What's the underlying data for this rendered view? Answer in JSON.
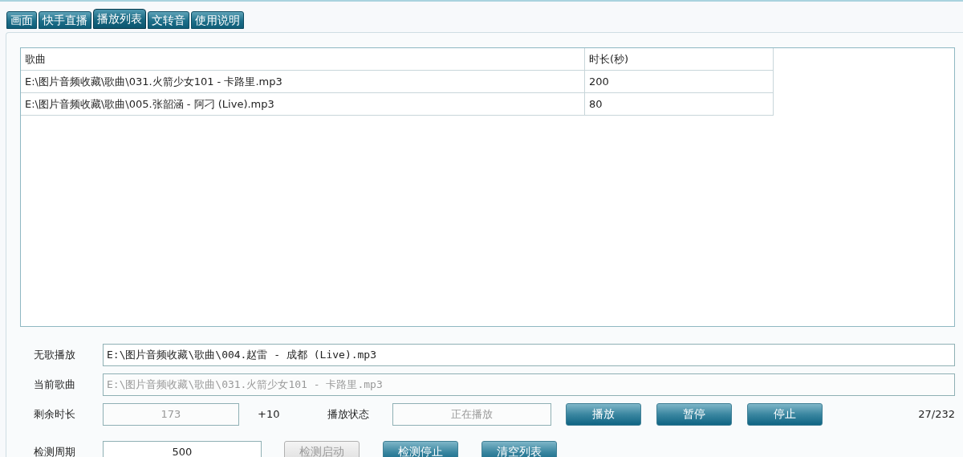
{
  "tabs": [
    {
      "label": "画面",
      "selected": false
    },
    {
      "label": "快手直播",
      "selected": false
    },
    {
      "label": "播放列表",
      "selected": true
    },
    {
      "label": "文转音",
      "selected": false
    },
    {
      "label": "使用说明",
      "selected": false
    }
  ],
  "playlist": {
    "columns": [
      "歌曲",
      "时长(秒)"
    ],
    "rows": [
      [
        "E:\\图片音频收藏\\歌曲\\031.火箭少女101 - 卡路里.mp3",
        "200"
      ],
      [
        "E:\\图片音频收藏\\歌曲\\005.张韶涵 - 阿刁 (Live).mp3",
        "80"
      ]
    ]
  },
  "form_rows": [
    {
      "items": [
        {
          "kind": "label",
          "text": "无歌播放"
        },
        {
          "kind": "field",
          "value": "E:\\图片音频收藏\\歌曲\\004.赵雷 - 成都 (Live).mp3",
          "disabled": false
        }
      ]
    },
    {
      "items": [
        {
          "kind": "label",
          "text": "当前歌曲"
        },
        {
          "kind": "field",
          "value": "E:\\图片音频收藏\\歌曲\\031.火箭少女101 - 卡路里.mp3",
          "disabled": true
        }
      ]
    },
    {
      "items": [
        {
          "kind": "label",
          "text": "剩余时长"
        },
        {
          "kind": "field",
          "value": "173",
          "disabled": true
        },
        {
          "kind": "text",
          "text": "+10"
        },
        {
          "kind": "label",
          "text": "播放状态"
        },
        {
          "kind": "field",
          "value": "正在播放",
          "disabled": true
        },
        {
          "kind": "button",
          "label": "播放",
          "disabled": false
        },
        {
          "kind": "button",
          "label": "暂停",
          "disabled": false
        },
        {
          "kind": "button",
          "label": "停止",
          "disabled": false
        },
        {
          "kind": "counter",
          "text": "27/232"
        }
      ]
    },
    {
      "items": [
        {
          "kind": "label",
          "text": "检测周期"
        },
        {
          "kind": "field",
          "value": "500",
          "disabled": false
        },
        {
          "kind": "button",
          "label": "检测启动",
          "disabled": true
        },
        {
          "kind": "button",
          "label": "检测停止",
          "disabled": false
        },
        {
          "kind": "button",
          "label": "清空列表",
          "disabled": false
        }
      ]
    }
  ]
}
